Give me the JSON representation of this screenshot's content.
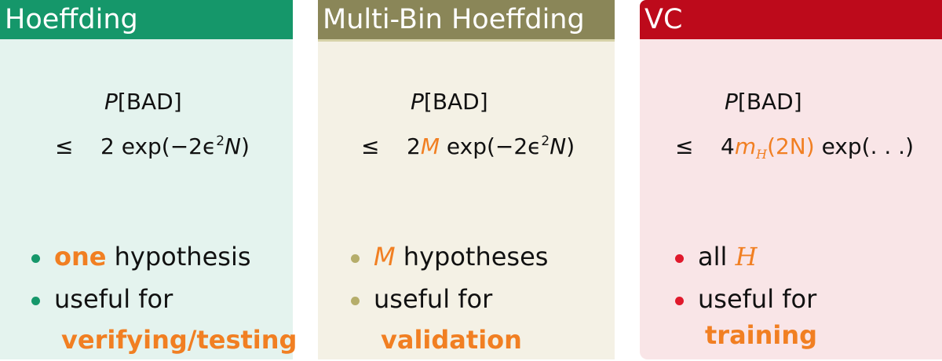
{
  "panels": [
    {
      "title": "Hoeffding",
      "prob": "P",
      "prob_arg": "[BAD]",
      "le": "≤",
      "bound_pre": "2 exp(−2ϵ",
      "bound_exp": "2",
      "bound_N": "N",
      "bound_post": ")",
      "bullet1_em": "one",
      "bullet1_rest": " hypothesis",
      "bullet2": "useful for",
      "bullet2_em": "verifying/testing"
    },
    {
      "title": "Multi-Bin Hoeffding",
      "prob": "P",
      "prob_arg": "[BAD]",
      "le": "≤",
      "bound_2": "2",
      "bound_M": "M",
      "bound_mid": " exp(−2ϵ",
      "bound_exp": "2",
      "bound_N": "N",
      "bound_post": ")",
      "bullet1_em": "M",
      "bullet1_rest": " hypotheses",
      "bullet2": "useful for",
      "bullet2_em": "validation"
    },
    {
      "title": "VC",
      "prob": "P",
      "prob_arg": "[BAD]",
      "le": "≤",
      "bound_4": "4",
      "bound_m": "m",
      "bound_H": "H",
      "bound_arg": "(2N)",
      "bound_post": " exp(. . .)",
      "bullet1_pre": "all ",
      "bullet1_em": "H",
      "bullet2": "useful for",
      "bullet2_em": "training"
    }
  ],
  "colors": {
    "hoeffding_header": "#15976a",
    "multibin_header": "#8a8658",
    "vc_header": "#bd0a1b",
    "emphasis": "#f17f22"
  }
}
